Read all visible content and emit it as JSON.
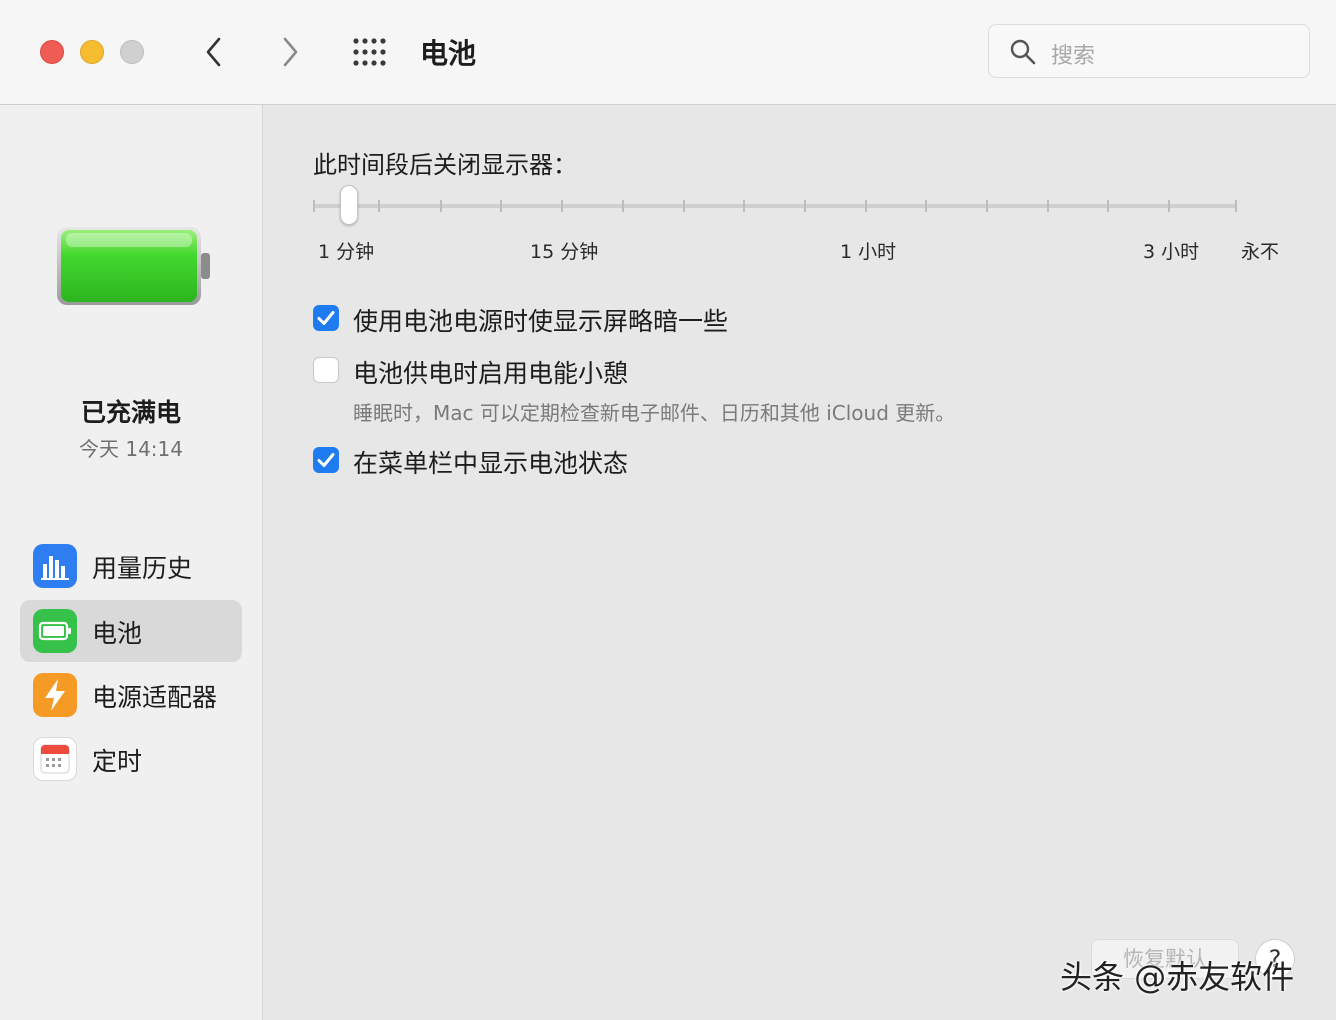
{
  "window": {
    "title": "电池",
    "search_placeholder": "搜索"
  },
  "sidebar": {
    "status_title": "已充满电",
    "status_time": "今天 14:14",
    "items": [
      {
        "label": "用量历史",
        "icon": "bar-chart-icon",
        "color": "#2f7ef1"
      },
      {
        "label": "电池",
        "icon": "battery-icon",
        "color": "#36c24a",
        "selected": true
      },
      {
        "label": "电源适配器",
        "icon": "lightning-icon",
        "color": "#f59a24"
      },
      {
        "label": "定时",
        "icon": "calendar-icon",
        "color": "#ffffff"
      }
    ]
  },
  "main": {
    "display_off_label": "此时间段后关闭显示器：",
    "slider": {
      "tick_count": 16,
      "selected_index": 0,
      "labels": [
        "1 分钟",
        "15 分钟",
        "1 小时",
        "3 小时",
        "永不"
      ]
    },
    "options": [
      {
        "label": "使用电池电源时使显示屏略暗一些",
        "checked": true
      },
      {
        "label": "电池供电时启用电能小憩",
        "checked": false,
        "description": "睡眠时，Mac 可以定期检查新电子邮件、日历和其他 iCloud 更新。"
      },
      {
        "label": "在菜单栏中显示电池状态",
        "checked": true
      }
    ],
    "restore_defaults": "恢复默认",
    "help": "?"
  },
  "watermark": "头条 @赤友软件",
  "colors": {
    "accent": "#1e7cf0",
    "battery_green": "#3fd13a"
  }
}
